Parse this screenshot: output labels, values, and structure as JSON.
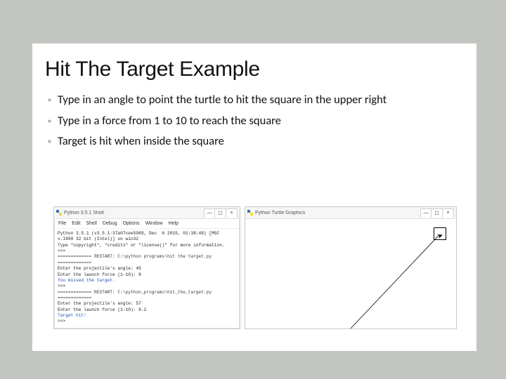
{
  "title": "Hit The Target Example",
  "bullets": [
    "Type in an angle to point the turtle to hit the square in the upper right",
    "Type in a force from 1 to 10 to reach the square",
    "Target is hit when inside the square"
  ],
  "shell_window": {
    "title": "Python 3.5.1 Shell",
    "min": "—",
    "max": "☐",
    "close": "×",
    "menu": [
      "File",
      "Edit",
      "Shell",
      "Debug",
      "Options",
      "Window",
      "Help"
    ],
    "body_version": "Python 3.5.1 (v3.5.1:37a07cee5969, Dec  6 2015, 01:38:48) [MSC v.1900 32 bit (Intel)] on win32",
    "body_hint": "Type \"copyright\", \"credits\" or \"license()\" for more information.",
    "prompt": ">>>",
    "restart1": "============= RESTART: C:\\python programs\\hit the target.py =============",
    "run1_l1": "Enter the projectile's angle: 45",
    "run1_l2": "Enter the launch force (1-10): 8",
    "run1_l3": "You missed the target.",
    "restart2": "============= RESTART: C:\\python_programs\\hit_the_target.py =============",
    "run2_l1": "Enter the projectile's angle: 57",
    "run2_l2": "Enter the launch force (1-10): 9.2",
    "run2_l3": "Target hit!"
  },
  "turtle_window": {
    "title": "Python Turtle Graphics",
    "min": "—",
    "max": "☐",
    "close": "×"
  }
}
